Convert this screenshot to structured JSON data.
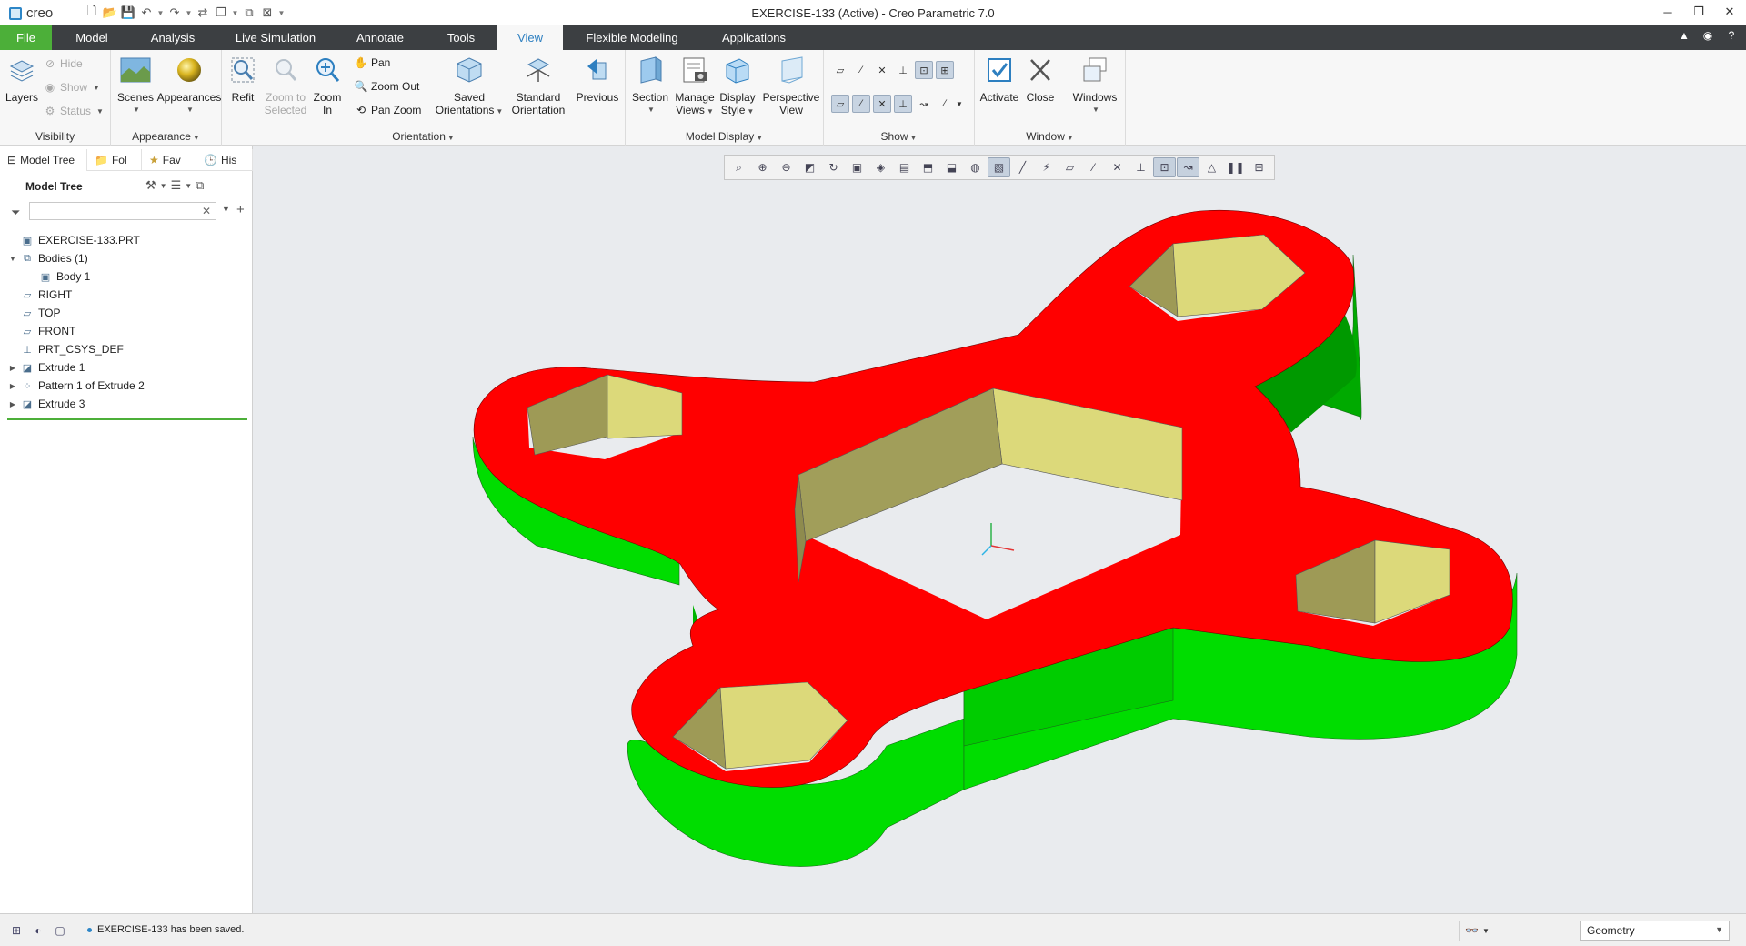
{
  "app": {
    "logo_text": "creo",
    "window_title": "EXERCISE-133 (Active) - Creo Parametric 7.0"
  },
  "ribbon_tabs": [
    "File",
    "Model",
    "Analysis",
    "Live Simulation",
    "Annotate",
    "Tools",
    "View",
    "Flexible Modeling",
    "Applications"
  ],
  "active_tab": "View",
  "ribbon": {
    "visibility": {
      "layers": "Layers",
      "hide": "Hide",
      "show": "Show",
      "status": "Status",
      "group": "Visibility"
    },
    "appearance": {
      "scenes": "Scenes",
      "appearances": "Appearances",
      "group": "Appearance"
    },
    "orientation": {
      "refit": "Refit",
      "zoom_selected_1": "Zoom to",
      "zoom_selected_2": "Selected",
      "zoom_in_1": "Zoom",
      "zoom_in_2": "In",
      "pan": "Pan",
      "zoom_out": "Zoom Out",
      "pan_zoom": "Pan Zoom",
      "saved_1": "Saved",
      "saved_2": "Orientations",
      "standard_1": "Standard",
      "standard_2": "Orientation",
      "previous": "Previous",
      "group": "Orientation"
    },
    "model_display": {
      "section": "Section",
      "manage_1": "Manage",
      "manage_2": "Views",
      "display_1": "Display",
      "display_2": "Style",
      "perspective_1": "Perspective",
      "perspective_2": "View",
      "group": "Model Display"
    },
    "show": {
      "group": "Show"
    },
    "window": {
      "activate": "Activate",
      "close": "Close",
      "windows": "Windows",
      "group": "Window"
    }
  },
  "left_panel": {
    "nav_tabs": [
      "Model Tree",
      "Folder Browser",
      "Favorites",
      "History"
    ],
    "nav_tabs_visible": [
      "Model Tree",
      "Fol",
      "Fav",
      "His"
    ],
    "header": "Model Tree",
    "search_value": "",
    "tree": [
      {
        "label": "EXERCISE-133.PRT",
        "icon": "part-icon",
        "indent": 0,
        "expander": ""
      },
      {
        "label": "Bodies (1)",
        "icon": "bodies-icon",
        "indent": 0,
        "expander": "▼"
      },
      {
        "label": "Body 1",
        "icon": "body-icon",
        "indent": 1,
        "expander": ""
      },
      {
        "label": "RIGHT",
        "icon": "datum-plane-icon",
        "indent": 0,
        "expander": ""
      },
      {
        "label": "TOP",
        "icon": "datum-plane-icon",
        "indent": 0,
        "expander": ""
      },
      {
        "label": "FRONT",
        "icon": "datum-plane-icon",
        "indent": 0,
        "expander": ""
      },
      {
        "label": "PRT_CSYS_DEF",
        "icon": "csys-icon",
        "indent": 0,
        "expander": ""
      },
      {
        "label": "Extrude 1",
        "icon": "extrude-icon",
        "indent": 0,
        "expander": "▶"
      },
      {
        "label": "Pattern 1 of Extrude 2",
        "icon": "pattern-icon",
        "indent": 0,
        "expander": "▶"
      },
      {
        "label": "Extrude 3",
        "icon": "extrude-icon",
        "indent": 0,
        "expander": "▶"
      }
    ]
  },
  "graphics": {
    "colors": {
      "background": "#e9ebee",
      "top_face": "#ff0000",
      "side_face": "#00dd00",
      "side_face_dark": "#00b300",
      "hole_light": "#dcd97a",
      "hole_dark": "#9e9a56"
    }
  },
  "status_bar": {
    "message": "EXERCISE-133 has been saved.",
    "filter_value": "Geometry"
  }
}
